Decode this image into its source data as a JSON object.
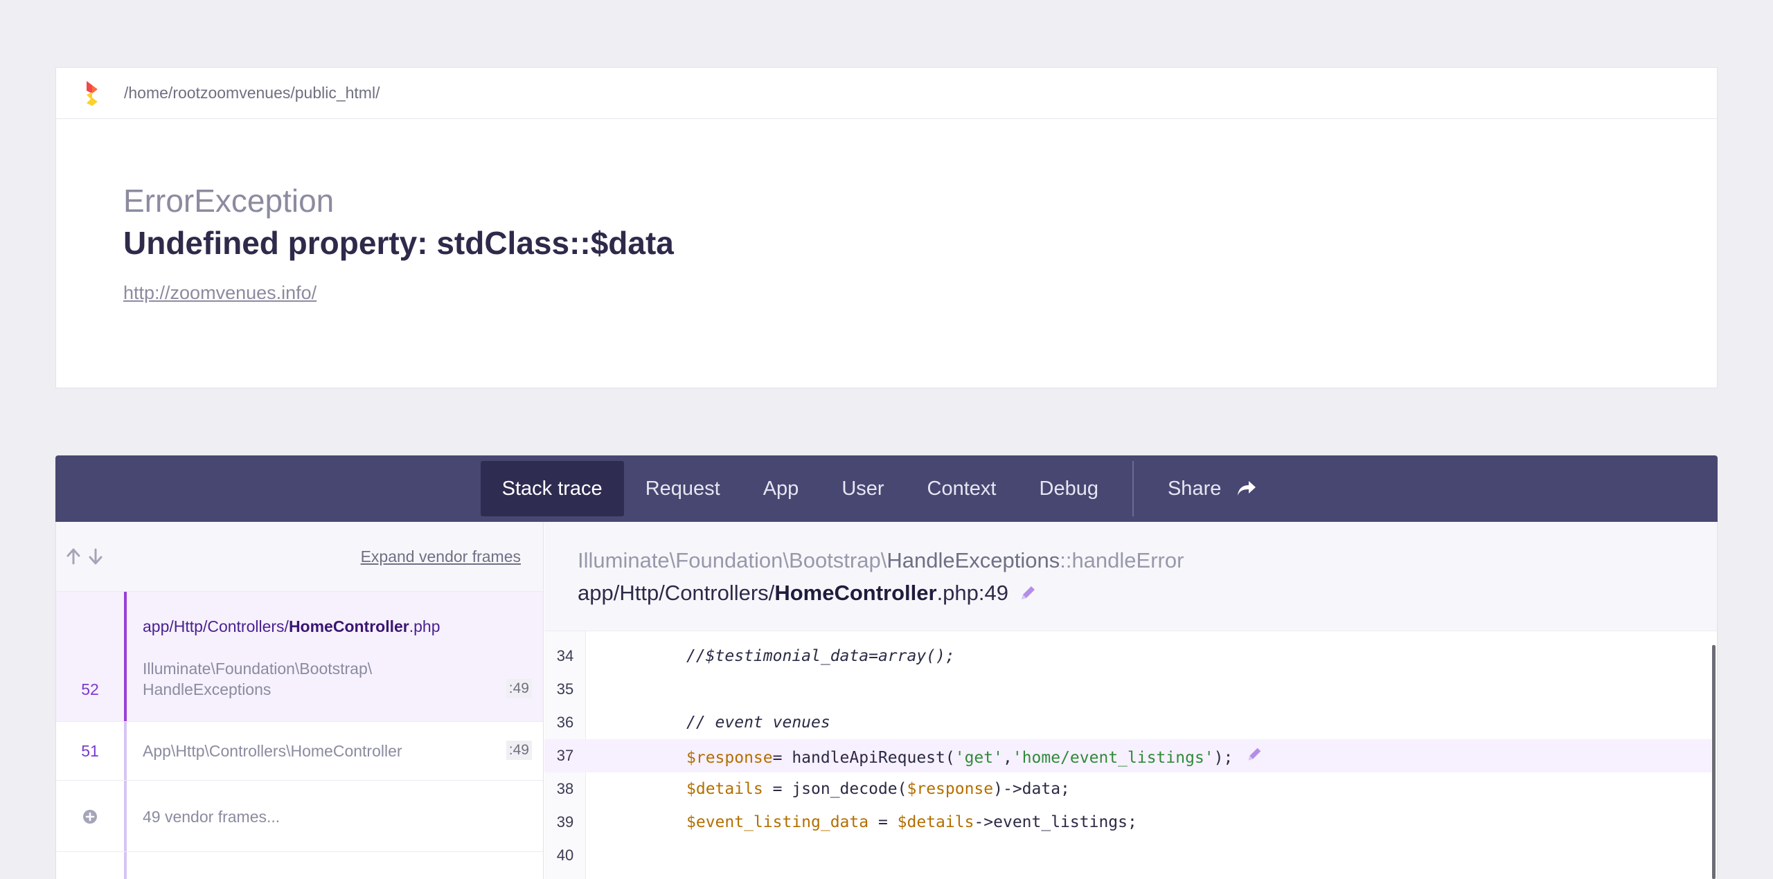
{
  "header": {
    "path": "/home/rootzoomvenues/public_html/",
    "exception_class": "ErrorException",
    "message": "Undefined property: stdClass::$data",
    "url": "http://zoomvenues.info/"
  },
  "nav": {
    "tabs": [
      "Stack trace",
      "Request",
      "App",
      "User",
      "Context",
      "Debug"
    ],
    "active": "Stack trace",
    "share_label": "Share"
  },
  "frames_panel": {
    "expand_label": "Expand vendor frames",
    "frames": [
      {
        "number": "52",
        "file_prefix": "app/Http/Controllers/",
        "file_name": "HomeController",
        "file_ext": ".php",
        "class_line1": "Illuminate\\Foundation\\Bootstrap\\",
        "class_line2": "HandleExceptions",
        "line": ":49"
      },
      {
        "number": "51",
        "class_line1": "App\\Http\\Controllers\\HomeController",
        "line": ":49"
      }
    ],
    "vendor_frames_label": "49 vendor frames..."
  },
  "code_panel": {
    "handler_prefix": "Illuminate\\Foundation\\Bootstrap\\",
    "handler_class": "HandleExceptions",
    "handler_method": "::handleError",
    "file_prefix": "app/Http/Controllers/",
    "file_name": "HomeController",
    "file_suffix": ".php:49",
    "lines": [
      {
        "n": "34",
        "text": "//$testimonial_data=array();"
      },
      {
        "n": "35",
        "text": ""
      },
      {
        "n": "36",
        "text": "// event venues"
      },
      {
        "n": "37",
        "text": "$response= handleApiRequest('get','home/event_listings');"
      },
      {
        "n": "38",
        "text": "$details = json_decode($response)->data;"
      },
      {
        "n": "39",
        "text": "$event_listing_data = $details->event_listings;"
      },
      {
        "n": "40",
        "text": ""
      }
    ],
    "highlighted_line": "37"
  },
  "colors": {
    "nav_bg": "#484771",
    "nav_active": "#2e2c51",
    "accent": "#9a3ed8",
    "string": "#2e8b3a",
    "variable": "#b36f00"
  },
  "icons": [
    "ignition-logo-icon",
    "share-arrow-icon",
    "arrow-up-icon",
    "arrow-down-icon",
    "pencil-edit-icon",
    "plus-circle-icon"
  ]
}
